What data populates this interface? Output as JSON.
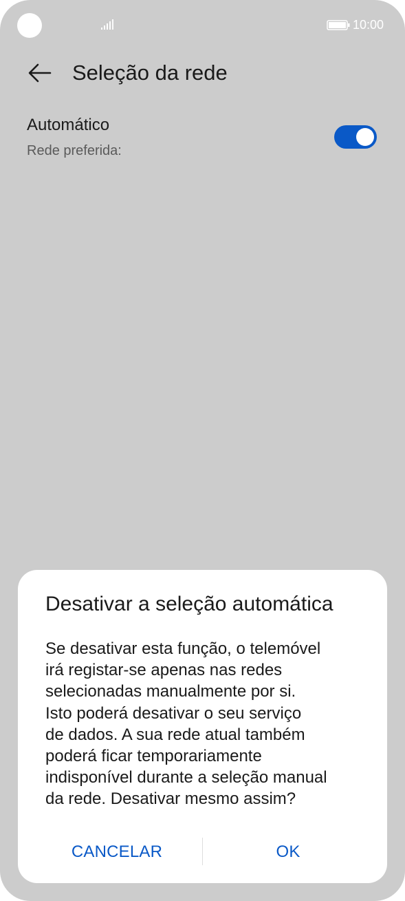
{
  "status_bar": {
    "time": "10:00",
    "battery_icon": "battery-icon",
    "signal_icon": "signal-icon"
  },
  "header": {
    "back_icon": "arrow-left-icon",
    "title": "Seleção da rede"
  },
  "setting": {
    "title": "Automático",
    "subtitle": "Rede preferida:",
    "toggle_on": true,
    "accent_color": "#0a59c7"
  },
  "dialog": {
    "title": "Desativar a seleção automática",
    "message": "Se desativar esta função, o telemóvel\nirá registar-se apenas nas redes\nselecionadas manualmente por si.\nIsto poderá desativar o seu serviço\nde dados. A sua rede atual também\npoderá ficar temporariamente\nindisponível durante a seleção manual\nda rede. Desativar mesmo assim?",
    "cancel_label": "CANCELAR",
    "ok_label": "OK"
  }
}
